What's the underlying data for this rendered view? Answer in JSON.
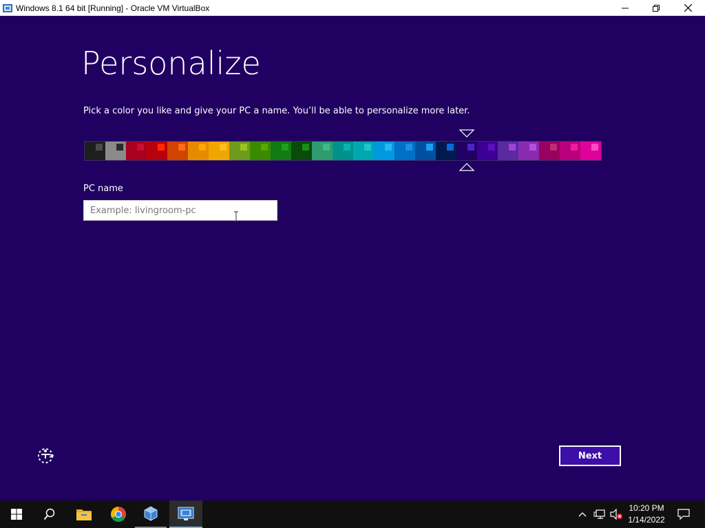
{
  "window": {
    "title": "Windows 8.1 64 bit [Running] - Oracle VM VirtualBox",
    "app_icon": "virtualbox-icon",
    "controls": [
      "minimize-icon",
      "maximize-icon",
      "close-icon"
    ]
  },
  "setup": {
    "heading": "Personalize",
    "subtext": "Pick a color you like and give your PC a name. You’ll be able to personalize more later.",
    "selected_color_index": 18,
    "colors": [
      {
        "bg": "#1e1e1e",
        "chip": "#4a4a4a"
      },
      {
        "bg": "#8a8a8a",
        "chip": "#2a2a2a"
      },
      {
        "bg": "#a8001e",
        "chip": "#c8102e"
      },
      {
        "bg": "#b8000e",
        "chip": "#ff2a00"
      },
      {
        "bg": "#d04400",
        "chip": "#ff6a1a"
      },
      {
        "bg": "#e68a00",
        "chip": "#ffa800"
      },
      {
        "bg": "#f0a500",
        "chip": "#ffc01a"
      },
      {
        "bg": "#6e9a1e",
        "chip": "#9bc41c"
      },
      {
        "bg": "#3a8a00",
        "chip": "#58a800"
      },
      {
        "bg": "#137a13",
        "chip": "#1e9e1e"
      },
      {
        "bg": "#0a4a0a",
        "chip": "#1a8c1a"
      },
      {
        "bg": "#2e9c6e",
        "chip": "#41b887"
      },
      {
        "bg": "#00928a",
        "chip": "#00b6ad"
      },
      {
        "bg": "#00a7b0",
        "chip": "#1ac8cc"
      },
      {
        "bg": "#0099e0",
        "chip": "#2ab6f0"
      },
      {
        "bg": "#006fc6",
        "chip": "#1a8fe0"
      },
      {
        "bg": "#0050a0",
        "chip": "#1a9ef5"
      },
      {
        "bg": "#001a50",
        "chip": "#0a6ad8"
      },
      {
        "bg": "#200060",
        "chip": "#5020c8"
      },
      {
        "bg": "#3c0096",
        "chip": "#5a10c0"
      },
      {
        "bg": "#5a2a9e",
        "chip": "#9a44d8"
      },
      {
        "bg": "#8a2ab0",
        "chip": "#b050e0"
      },
      {
        "bg": "#9a0060",
        "chip": "#c02a78"
      },
      {
        "bg": "#b8007a",
        "chip": "#f01aa0"
      },
      {
        "bg": "#e0009a",
        "chip": "#ff4ac8"
      }
    ],
    "pc_name_label": "PC name",
    "pc_name_placeholder": "Example: livingroom-pc",
    "pc_name_value": "",
    "ease_of_access_icon": "ease-of-access-icon",
    "next_label": "Next"
  },
  "taskbar": {
    "items": [
      "windows-start-icon",
      "search-icon",
      "file-explorer-icon",
      "chrome-icon",
      "virtualbox-icon",
      "virtualbox-vm-icon"
    ],
    "tray": {
      "time": "10:20 PM",
      "date": "1/14/2022",
      "icons": [
        "chevron-up-icon",
        "network-icon",
        "volume-muted-icon",
        "notifications-icon"
      ]
    }
  }
}
